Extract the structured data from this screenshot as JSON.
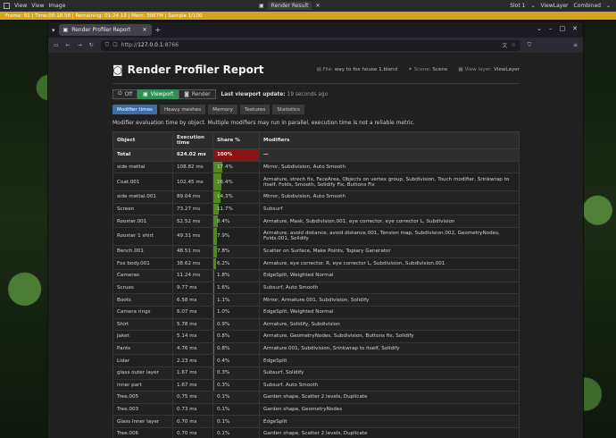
{
  "blender": {
    "menus": [
      "View",
      "View",
      "Image"
    ],
    "result_title": "Render Result",
    "slot": "Slot 1",
    "view_layer": "ViewLayer",
    "pass": "Combined"
  },
  "progress": {
    "text": "Frame: 91 | Time:00:18.58 | Remaining: 01:24.13 | Mem: 3067M | Sample 1/100",
    "fraction": 0.01,
    "color": "#d9a21f"
  },
  "browser": {
    "tab_title": "Render Profiler Report",
    "url_host": "127.0.0.1",
    "url_rest": ":8766",
    "url_prefix": "http://"
  },
  "report": {
    "title": "Render Profiler Report",
    "file_label": "File:",
    "file_value": "way to fox house 1.blend",
    "scene_label": "Scene:",
    "scene_value": "Scene",
    "layer_label": "View layer:",
    "layer_value": "ViewLayer",
    "modes": [
      {
        "label": "Off",
        "active": false
      },
      {
        "label": "Viewport",
        "active": true
      },
      {
        "label": "Render",
        "active": false
      }
    ],
    "last_update_label": "Last viewport update:",
    "last_update_value": "19 seconds ago",
    "tabs": [
      {
        "label": "Modifier times",
        "active": true
      },
      {
        "label": "Heavy meshes",
        "active": false
      },
      {
        "label": "Memory",
        "active": false
      },
      {
        "label": "Textures",
        "active": false
      },
      {
        "label": "Statistics",
        "active": false
      }
    ],
    "description": "Modifier evaluation time by object. Multiple modifiers may run in parallel, execution time is not a reliable metric.",
    "columns": [
      "Object",
      "Execution time",
      "Share %",
      "Modifiers"
    ],
    "total": {
      "object": "Total",
      "time": "624.02 ms",
      "share": "100%",
      "share_value": 100,
      "modifiers": "—"
    },
    "rows": [
      {
        "object": "side mettal",
        "time": "108.82 ms",
        "share": "17.4%",
        "share_value": 17.4,
        "modifiers": "Mirror, Subdivision, Auto Smooth"
      },
      {
        "object": "Coat.001",
        "time": "102.45 ms",
        "share": "16.4%",
        "share_value": 16.4,
        "modifiers": "Armature, strech fix, FaceArea, Objects on vertex group, Subdivision, Touch modifier, Srinkwrap to itself, Folds, Smooth, Solidify Fix, Buttons Fix",
        "tall": true
      },
      {
        "object": "side mettal.001",
        "time": "89.04 ms",
        "share": "14.3%",
        "share_value": 14.3,
        "modifiers": "Mirror, Subdivision, Auto Smooth"
      },
      {
        "object": "Screen",
        "time": "73.27 ms",
        "share": "11.7%",
        "share_value": 11.7,
        "modifiers": "Subsurf"
      },
      {
        "object": "Rooster.001",
        "time": "52.52 ms",
        "share": "8.4%",
        "share_value": 8.4,
        "modifiers": "Armature, Mask, Subdivision.001, eye corrector, eye corrector L, Subdivision"
      },
      {
        "object": "Rooster 1 shirt",
        "time": "49.31 ms",
        "share": "7.9%",
        "share_value": 7.9,
        "modifiers": "Armature, avoid distance, avoid distance.001, Tension map, Subdivision.002, GeometryNodes, Folds.001, Solidify",
        "tall": true
      },
      {
        "object": "Bench.001",
        "time": "48.51 ms",
        "share": "7.8%",
        "share_value": 7.8,
        "modifiers": "Scatter on Surface, Make Points, Topiary Generator"
      },
      {
        "object": "Fox body.001",
        "time": "38.62 ms",
        "share": "6.2%",
        "share_value": 6.2,
        "modifiers": "Armature, eye corrector. R, eye corrector L, Subdivision, Subdivision.001"
      },
      {
        "object": "Cameras",
        "time": "11.24 ms",
        "share": "1.8%",
        "share_value": 1.8,
        "modifiers": "EdgeSplit, Weighted Normal"
      },
      {
        "object": "Scrues",
        "time": "9.77 ms",
        "share": "1.6%",
        "share_value": 1.6,
        "modifiers": "Subsurf, Auto Smooth"
      },
      {
        "object": "Boots",
        "time": "6.58 ms",
        "share": "1.1%",
        "share_value": 1.1,
        "modifiers": "Mirror, Armature.001, Subdivision, Solidify"
      },
      {
        "object": "Camera rings",
        "time": "6.07 ms",
        "share": "1.0%",
        "share_value": 1.0,
        "modifiers": "EdgeSplit, Weighted Normal"
      },
      {
        "object": "Shirt",
        "time": "5.78 ms",
        "share": "0.9%",
        "share_value": 0.9,
        "modifiers": "Armature, Solidify, Subdivision"
      },
      {
        "object": "Jaket",
        "time": "5.14 ms",
        "share": "0.8%",
        "share_value": 0.8,
        "modifiers": "Armature, GeometryNodes, Subdivision, Buttons fix, Solidify"
      },
      {
        "object": "Pants",
        "time": "4.76 ms",
        "share": "0.8%",
        "share_value": 0.8,
        "modifiers": "Armature.001, Subdivision, Srinkwrap to itself, Solidify"
      },
      {
        "object": "Lidar",
        "time": "2.23 ms",
        "share": "0.4%",
        "share_value": 0.4,
        "modifiers": "EdgeSplit"
      },
      {
        "object": "glass outer layer",
        "time": "1.67 ms",
        "share": "0.3%",
        "share_value": 0.3,
        "modifiers": "Subsurf, Solidify"
      },
      {
        "object": "inner part",
        "time": "1.67 ms",
        "share": "0.3%",
        "share_value": 0.3,
        "modifiers": "Subsurf, Auto Smooth"
      },
      {
        "object": "Tree.005",
        "time": "0.75 ms",
        "share": "0.1%",
        "share_value": 0.1,
        "modifiers": "Garden shape, Scatter 2 levels, Duplicate"
      },
      {
        "object": "Tree.003",
        "time": "0.73 ms",
        "share": "0.1%",
        "share_value": 0.1,
        "modifiers": "Garden shape, GeometryNodes"
      },
      {
        "object": "Glass Inner layer",
        "time": "0.70 ms",
        "share": "0.1%",
        "share_value": 0.1,
        "modifiers": "EdgeSplit"
      },
      {
        "object": "Tree.006",
        "time": "0.70 ms",
        "share": "0.1%",
        "share_value": 0.1,
        "modifiers": "Garden shape, Scatter 2 levels, Duplicate"
      }
    ],
    "colors": {
      "accent": "#3d6ea8",
      "viewport_active": "#2f8f56",
      "share_bar": "#4f8a1e",
      "share_total": "#8a1212"
    }
  }
}
